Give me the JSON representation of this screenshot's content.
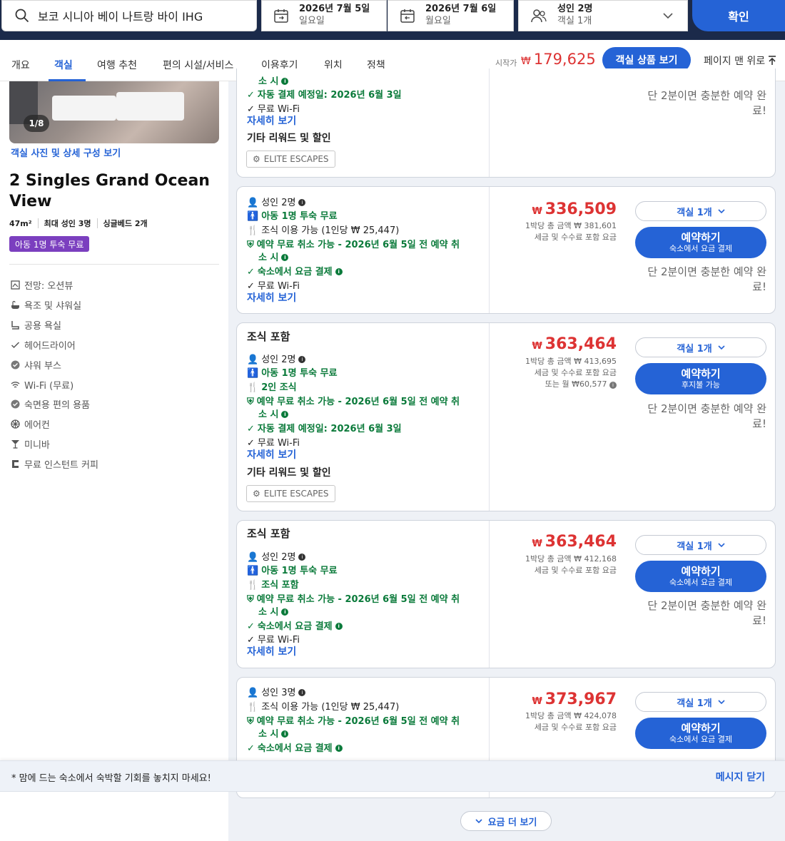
{
  "search": {
    "query": "보코 시니아 베이 나트랑 바이 IHG"
  },
  "checkin": {
    "date": "2026년 7월 5일",
    "day": "일요일"
  },
  "checkout": {
    "date": "2026년 7월 6일",
    "day": "월요일"
  },
  "guests": {
    "adults": "성인 2명",
    "rooms": "객실 1개"
  },
  "confirm_label": "확인",
  "nav": {
    "tabs": [
      "개요",
      "객실",
      "여행 추천",
      "편의 시설/서비스",
      "이용후기",
      "위치",
      "정책"
    ],
    "start_label": "시작가",
    "currency": "₩",
    "start_price": "179,625",
    "view_rooms": "객실 상품 보기",
    "back_to_top": "페이지 맨 위로"
  },
  "room": {
    "photo_counter": "1/8",
    "photo_link": "객실 사진 및 상세 구성 보기",
    "title": "2 Singles Grand Ocean View",
    "size": "47m²",
    "max_adults": "최대 성인 3명",
    "beds": "싱글베드 2개",
    "kid_badge": "아동 1명 투숙 무료",
    "amenities": [
      "전망: 오션뷰",
      "욕조 및 샤워실",
      "공용 욕실",
      "헤어드라이어",
      "샤워 부스",
      "Wi-Fi (무료)",
      "숙면용 편의 용품",
      "에어컨",
      "미니바",
      "무료 인스턴트 커피"
    ]
  },
  "card0": {
    "cut_text": "소 시",
    "auto_pay": "자동 결제 예정일: 2026년 6월 3일",
    "wifi": "무료 Wi-Fi",
    "details": "자세히 보기",
    "rewards": "기타 리워드 및 할인",
    "elite": "ELITE ESCAPES",
    "hint": "단 2분이면 충분한 예약 완료!"
  },
  "card1": {
    "adults": "성인 2명",
    "kid": "아동 1명 투숙 무료",
    "breakfast": "조식 이용 가능 (1인당 ₩ 25,447)",
    "cancel": "예약 무료 취소 가능 - 2026년 6월 5일 전 예약 취",
    "cancel2": "소 시",
    "pay": "숙소에서 요금 결제",
    "wifi": "무료 Wi-Fi",
    "details": "자세히 보기",
    "price": "336,509",
    "total": "1박당 총 금액 ₩ 381,601",
    "tax": "세금 및 수수료 포함 요금",
    "rooms": "객실 1개",
    "book": "예약하기",
    "book_sub": "숙소에서 요금 결제",
    "hint": "단 2분이면 충분한 예약 완료!"
  },
  "card2": {
    "head": "조식 포함",
    "adults": "성인 2명",
    "kid": "아동 1명 투숙 무료",
    "breakfast": "2인 조식",
    "cancel": "예약 무료 취소 가능 - 2026년 6월 5일 전 예약 취",
    "cancel2": "소 시",
    "auto_pay": "자동 결제 예정일: 2026년 6월 3일",
    "wifi": "무료 Wi-Fi",
    "details": "자세히 보기",
    "rewards": "기타 리워드 및 할인",
    "elite": "ELITE ESCAPES",
    "price": "363,464",
    "total": "1박당 총 금액 ₩ 413,695",
    "tax": "세금 및 수수료 포함 요금",
    "monthly": "또는 월 ₩60,577",
    "rooms": "객실 1개",
    "book": "예약하기",
    "book_sub": "후지불 가능",
    "hint": "단 2분이면 충분한 예약 완료!"
  },
  "card3": {
    "head": "조식 포함",
    "adults": "성인 2명",
    "kid": "아동 1명 투숙 무료",
    "breakfast": "조식 포함",
    "cancel": "예약 무료 취소 가능 - 2026년 6월 5일 전 예약 취",
    "cancel2": "소 시",
    "pay": "숙소에서 요금 결제",
    "wifi": "무료 Wi-Fi",
    "details": "자세히 보기",
    "price": "363,464",
    "total": "1박당 총 금액 ₩ 412,168",
    "tax": "세금 및 수수료 포함 요금",
    "rooms": "객실 1개",
    "book": "예약하기",
    "book_sub": "숙소에서 요금 결제",
    "hint": "단 2분이면 충분한 예약 완료!"
  },
  "card4": {
    "adults": "성인 3명",
    "breakfast": "조식 이용 가능 (1인당 ₩ 25,447)",
    "cancel": "예약 무료 취소 가능 - 2026년 6월 5일 전 예약 취",
    "cancel2": "소 시",
    "pay": "숙소에서 요금 결제",
    "price": "373,967",
    "total": "1박당 총 금액 ₩ 424,078",
    "tax": "세금 및 수수료 포함 요금",
    "rooms": "객실 1개",
    "book": "예약하기",
    "book_sub": "숙소에서 요금 결제"
  },
  "banner": {
    "message": "* 맘에 드는 숙소에서 숙박할 기회를 놓치지 마세요!",
    "close": "메시지 닫기"
  },
  "more_rates": "요금 더 보기",
  "colors": {
    "primary": "#2563d6",
    "price": "#dd3333",
    "green": "#0a7a3a",
    "header": "#1b2a4a",
    "badge": "#7b3fbf"
  }
}
